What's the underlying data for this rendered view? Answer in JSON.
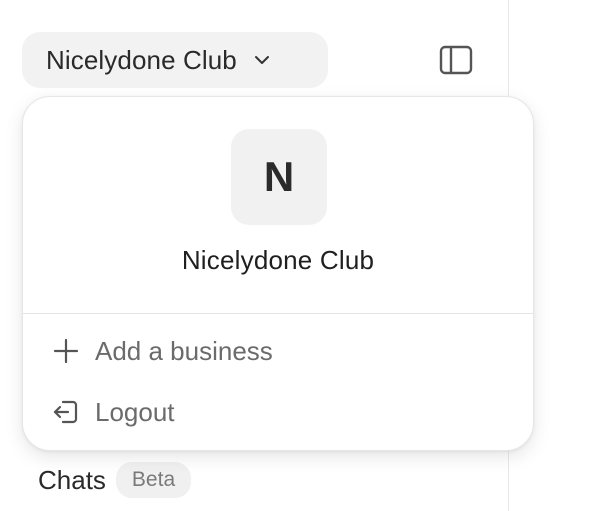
{
  "switcher": {
    "label": "Nicelydone Club",
    "chevron_icon": "chevron-down-icon"
  },
  "panel_toggle": {
    "icon": "sidebar-panel-icon"
  },
  "dropdown": {
    "avatar_letter": "N",
    "business_name": "Nicelydone Club",
    "items": [
      {
        "label": "Add a business",
        "icon": "plus-icon"
      },
      {
        "label": "Logout",
        "icon": "logout-icon"
      }
    ]
  },
  "sidebar": {
    "chats_label": "Chats",
    "chats_badge": "Beta"
  },
  "colors": {
    "switcher_bg": "#f2f2f2",
    "menu_text": "#6b6b6b",
    "badge_bg": "#f0f0f0"
  }
}
